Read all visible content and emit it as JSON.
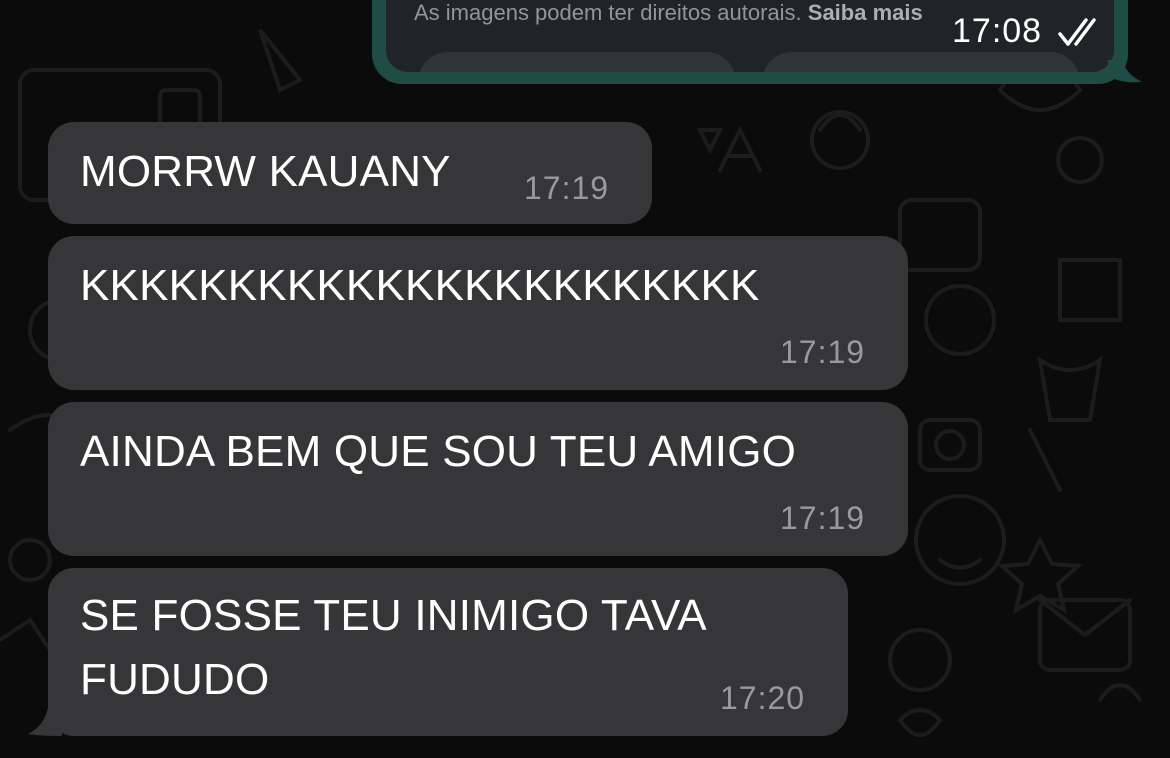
{
  "sent_message": {
    "caption_text": "As imagens podem ter direitos autorais.",
    "caption_link": "Saiba mais",
    "time": "17:08",
    "status_icon": "double-check-read-icon"
  },
  "messages": [
    {
      "text": "MORRW KAUANY",
      "time": "17:19"
    },
    {
      "text": "KKKKKKKKKKKKKKKKKKKKKKK",
      "time": "17:19"
    },
    {
      "text": "AINDA BEM QUE SOU TEU AMIGO",
      "time": "17:19"
    },
    {
      "text": "SE FOSSE TEU INIMIGO TAVA\nFUDUDO",
      "time": "17:20"
    }
  ],
  "colors": {
    "background": "#0b0b0b",
    "received_bubble": "#363638",
    "sent_bubble_border": "#1f4c45",
    "time_text": "#9a9a9e"
  }
}
